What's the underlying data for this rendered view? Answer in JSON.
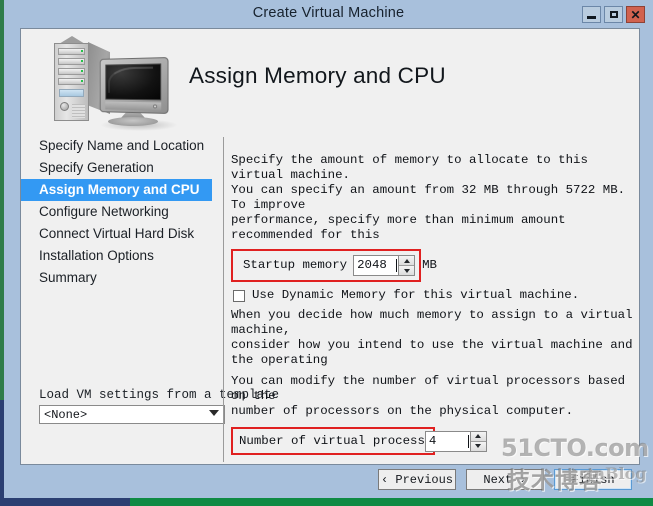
{
  "window": {
    "title": "Create Virtual Machine",
    "controls": {
      "minimize": "minimize-button",
      "maximize": "maximize-button",
      "close": "✕"
    }
  },
  "header": {
    "page_title": "Assign Memory and CPU",
    "icon": "server-computer-icon"
  },
  "sidebar": {
    "items": [
      {
        "label": "Specify Name and Location",
        "active": false
      },
      {
        "label": "Specify Generation",
        "active": false
      },
      {
        "label": "Assign Memory and CPU",
        "active": true
      },
      {
        "label": "Configure Networking",
        "active": false
      },
      {
        "label": "Connect Virtual Hard Disk",
        "active": false
      },
      {
        "label": "Installation Options",
        "active": false
      },
      {
        "label": "Summary",
        "active": false
      }
    ],
    "template": {
      "label": "Load VM settings from a template",
      "selected": "<None>"
    }
  },
  "content": {
    "memory_intro": "Specify the amount of memory to allocate to this virtual machine.\nYou can specify an amount from 32 MB through 5722 MB. To improve\nperformance, specify more than minimum amount recommended for this",
    "startup_memory": {
      "label": "Startup memory",
      "value": "2048",
      "unit": "MB"
    },
    "dynamic_memory": {
      "label": "Use Dynamic Memory for this virtual machine.",
      "checked": false
    },
    "memory_note": "When you decide how much memory to assign to a virtual machine,\nconsider how you intend to use the virtual machine and the operating",
    "cpu_intro": "You can modify the number of virtual processors based on the\nnumber of processors on the physical computer.",
    "virtual_processors": {
      "label": "Number of virtual process",
      "value": "4"
    }
  },
  "footer": {
    "previous": "‹ Previous",
    "next": "Next ›",
    "finish": "Finish"
  },
  "watermark": {
    "site": "51CTO.com",
    "chinese": "技术博客",
    "blog": "anBlog"
  },
  "colors": {
    "accent": "#3399f3",
    "annotation": "#e02020",
    "titlebar": "#a8c0dc",
    "close_button": "#d1624f",
    "client_bg": "#f0f0f0"
  }
}
